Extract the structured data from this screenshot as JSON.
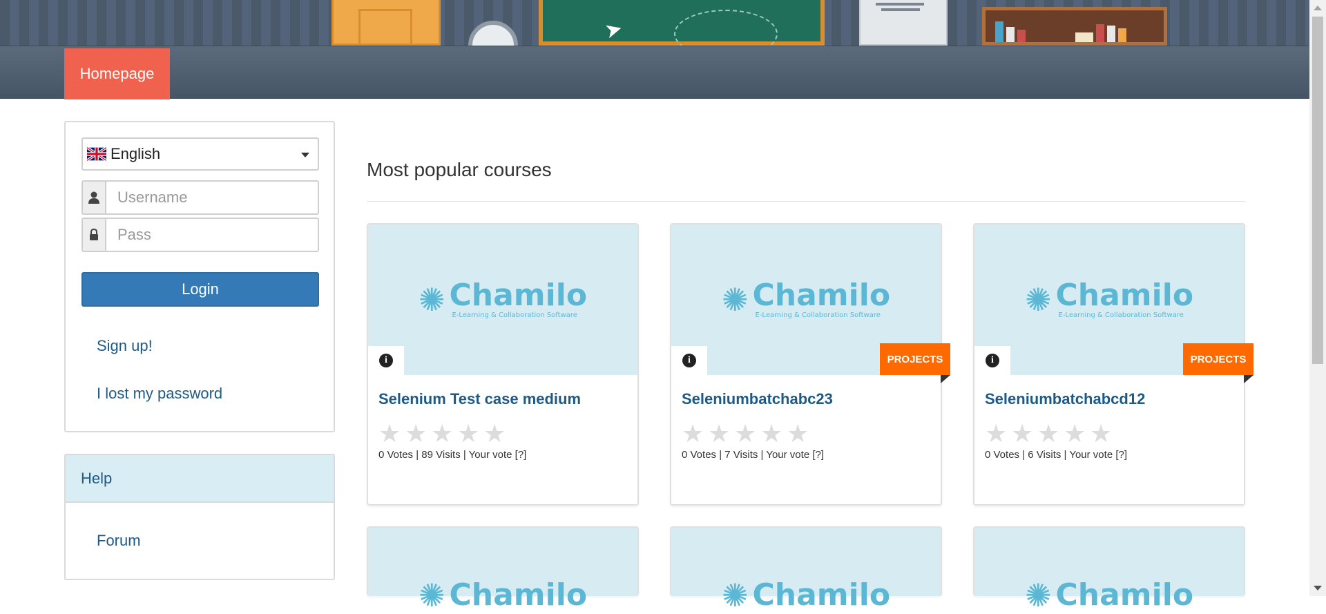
{
  "nav": {
    "homepage_label": "Homepage"
  },
  "login": {
    "language": "English",
    "username_placeholder": "Username",
    "password_placeholder": "Pass",
    "login_label": "Login",
    "signup_label": "Sign up!",
    "lost_password_label": "I lost my password"
  },
  "help": {
    "heading": "Help",
    "forum_label": "Forum"
  },
  "main": {
    "section_title": "Most popular courses"
  },
  "logo": {
    "word": "Chamilo",
    "sub": "E-Learning & Collaboration Software"
  },
  "courses": [
    {
      "title": "Selenium Test case medium",
      "votes": "0 Votes",
      "visits": "89 Visits",
      "your_vote": "Your vote [?]",
      "badge": "",
      "rating": 0
    },
    {
      "title": "Seleniumbatchabc23",
      "votes": "0 Votes",
      "visits": "7 Visits",
      "your_vote": "Your vote [?]",
      "badge": "PROJECTS",
      "rating": 0
    },
    {
      "title": "Seleniumbatchabcd12",
      "votes": "0 Votes",
      "visits": "6 Visits",
      "your_vote": "Your vote [?]",
      "badge": "PROJECTS",
      "rating": 0
    }
  ],
  "colors": {
    "nav_active": "#f0624d",
    "login_button": "#337ab7",
    "link": "#1f5a85",
    "badge": "#ff6a00",
    "thumb_bg": "#d7ecf2",
    "logo": "#5bb7d4"
  }
}
